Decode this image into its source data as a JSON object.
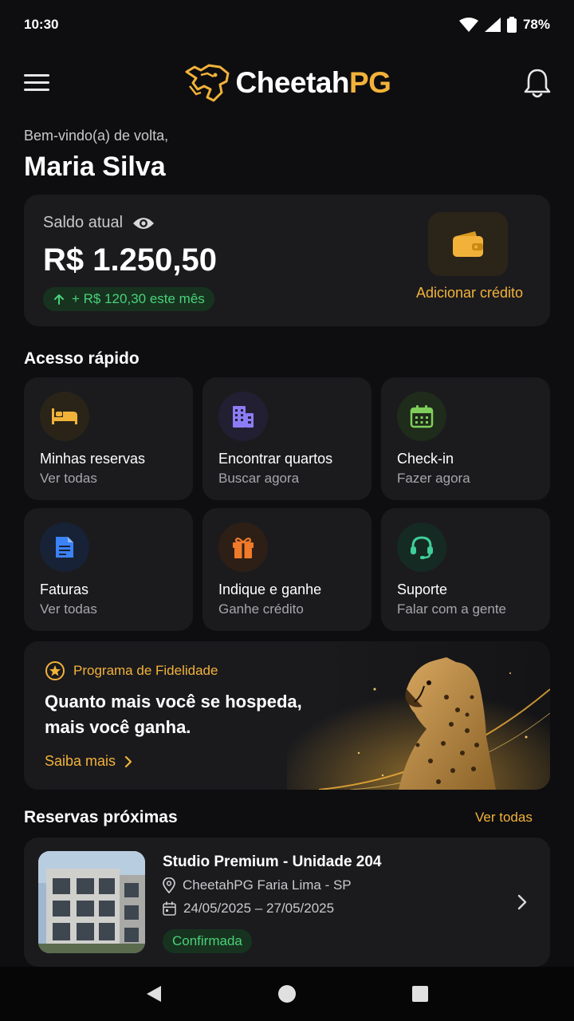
{
  "status_bar": {
    "time": "10:30",
    "battery": "78%"
  },
  "header": {
    "brand_first": "Cheetah",
    "brand_second": "PG"
  },
  "greeting": {
    "subtitle": "Bem-vindo(a) de volta,",
    "name": "Maria Silva"
  },
  "balance": {
    "label": "Saldo atual",
    "amount": "R$ 1.250,50",
    "delta": "+ R$ 120,30 este mês",
    "add_credit": "Adicionar crédito"
  },
  "quick_access": {
    "title": "Acesso rápido",
    "tiles": [
      {
        "title": "Minhas reservas",
        "subtitle": "Ver todas",
        "icon": "bed-icon",
        "color": "#f2b23a"
      },
      {
        "title": "Encontrar quartos",
        "subtitle": "Buscar agora",
        "icon": "building-icon",
        "color": "#8b7cf6"
      },
      {
        "title": "Check-in",
        "subtitle": "Fazer agora",
        "icon": "calendar-icon",
        "color": "#7fcf5a"
      },
      {
        "title": "Faturas",
        "subtitle": "Ver todas",
        "icon": "document-icon",
        "color": "#3b82f6"
      },
      {
        "title": "Indique e ganhe",
        "subtitle": "Ganhe crédito",
        "icon": "gift-icon",
        "color": "#f07a2a"
      },
      {
        "title": "Suporte",
        "subtitle": "Falar com a gente",
        "icon": "headset-icon",
        "color": "#3fcf9a"
      }
    ]
  },
  "loyalty": {
    "tag": "Programa de Fidelidade",
    "headline": "Quanto mais você se hospeda, mais você ganha.",
    "cta": "Saiba mais"
  },
  "reservations": {
    "title": "Reservas próximas",
    "see_all": "Ver todas",
    "items": [
      {
        "title": "Studio Premium - Unidade 204",
        "location": "CheetahPG Faria Lima - SP",
        "dates": "24/05/2025 – 27/05/2025",
        "status": "Confirmada"
      }
    ]
  },
  "colors": {
    "accent": "#f2b23a",
    "success": "#4bd07a",
    "background": "#0e0e10",
    "card": "#1b1b1e"
  }
}
